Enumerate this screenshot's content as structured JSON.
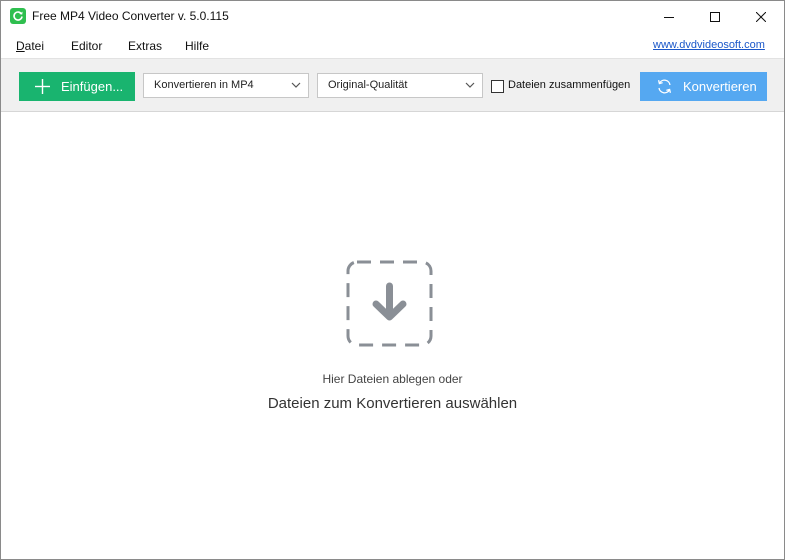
{
  "window": {
    "title": "Free MP4 Video Converter v. 5.0.115"
  },
  "menu": {
    "items": [
      "Datei",
      "Editor",
      "Extras",
      "Hilfe"
    ],
    "site_link": "www.dvdvideosoft.com"
  },
  "toolbar": {
    "add_label": "Einfügen...",
    "format_value": "Konvertieren in MP4",
    "quality_value": "Original-Qualität",
    "merge_label": "Dateien zusammenfügen",
    "merge_checked": false,
    "convert_label": "Konvertieren"
  },
  "dropzone": {
    "line1": "Hier Dateien ablegen oder",
    "line2": "Dateien zum Konvertieren auswählen"
  },
  "colors": {
    "add_button": "#19b46f",
    "convert_button": "#55a8f1",
    "link": "#1a57c9",
    "drop_icon": "#8a8f96"
  },
  "icons": {
    "app": "refresh-circle-icon",
    "add": "plus-icon",
    "convert": "refresh-icon",
    "drop": "download-arrow-icon"
  }
}
